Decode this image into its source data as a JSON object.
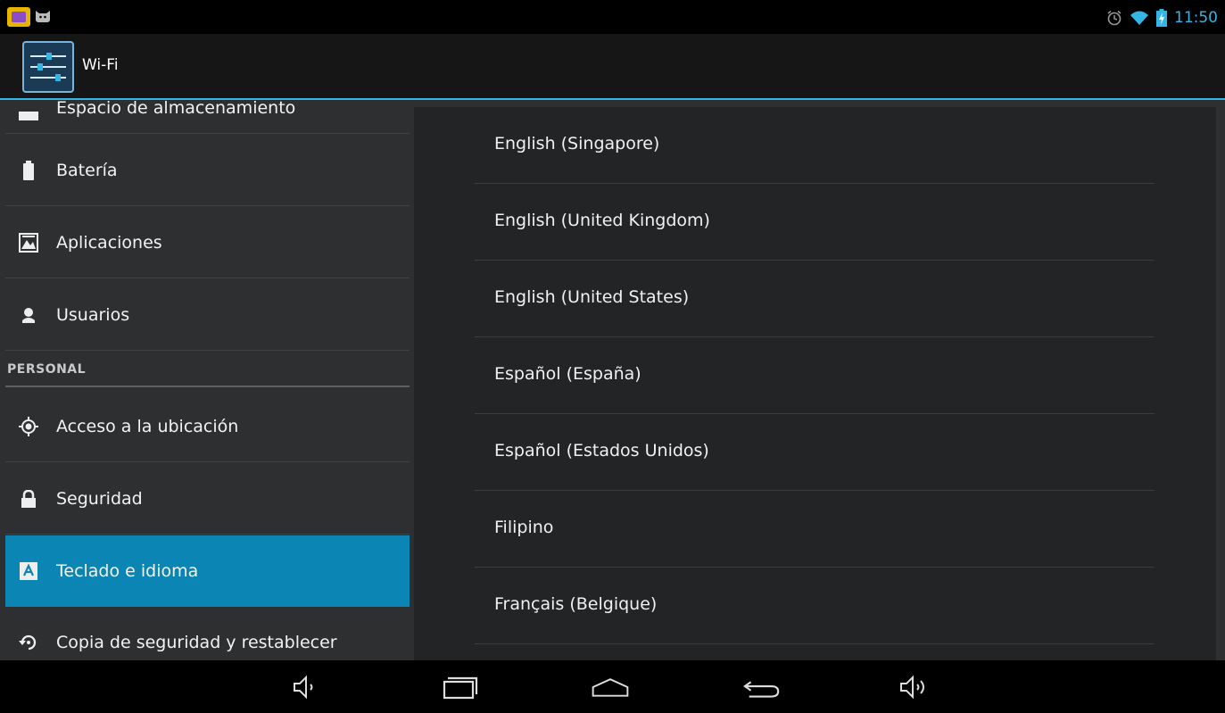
{
  "status_bar": {
    "time": "11:50",
    "notification_icons": [
      "app-notification-icon",
      "cat-icon"
    ],
    "system_icons": [
      "alarm-icon",
      "wifi-icon",
      "battery-charging-icon"
    ],
    "accent_color": "#33b5e5"
  },
  "action_bar": {
    "title": "Wi-Fi",
    "icon": "settings-sliders-icon"
  },
  "sidebar": {
    "items": [
      {
        "label": "Espacio de almacenamiento",
        "icon": "storage-icon"
      },
      {
        "label": "Batería",
        "icon": "battery-icon"
      },
      {
        "label": "Aplicaciones",
        "icon": "apps-icon"
      },
      {
        "label": "Usuarios",
        "icon": "users-icon"
      }
    ],
    "section_header": "PERSONAL",
    "personal_items": [
      {
        "label": "Acceso a la ubicación",
        "icon": "location-icon"
      },
      {
        "label": "Seguridad",
        "icon": "lock-icon"
      },
      {
        "label": "Teclado e idioma",
        "icon": "keyboard-language-icon",
        "selected": true
      },
      {
        "label": "Copia de seguridad y restablecer",
        "icon": "backup-restore-icon"
      }
    ],
    "selected_color": "#0b85b4"
  },
  "language_list": {
    "items": [
      "English (Singapore)",
      "English (United Kingdom)",
      "English (United States)",
      "Español (España)",
      "Español (Estados Unidos)",
      "Filipino",
      "Français (Belgique)"
    ]
  },
  "nav_bar": {
    "buttons": [
      "volume-down-icon",
      "recent-apps-icon",
      "home-icon",
      "back-icon",
      "volume-up-icon"
    ]
  }
}
